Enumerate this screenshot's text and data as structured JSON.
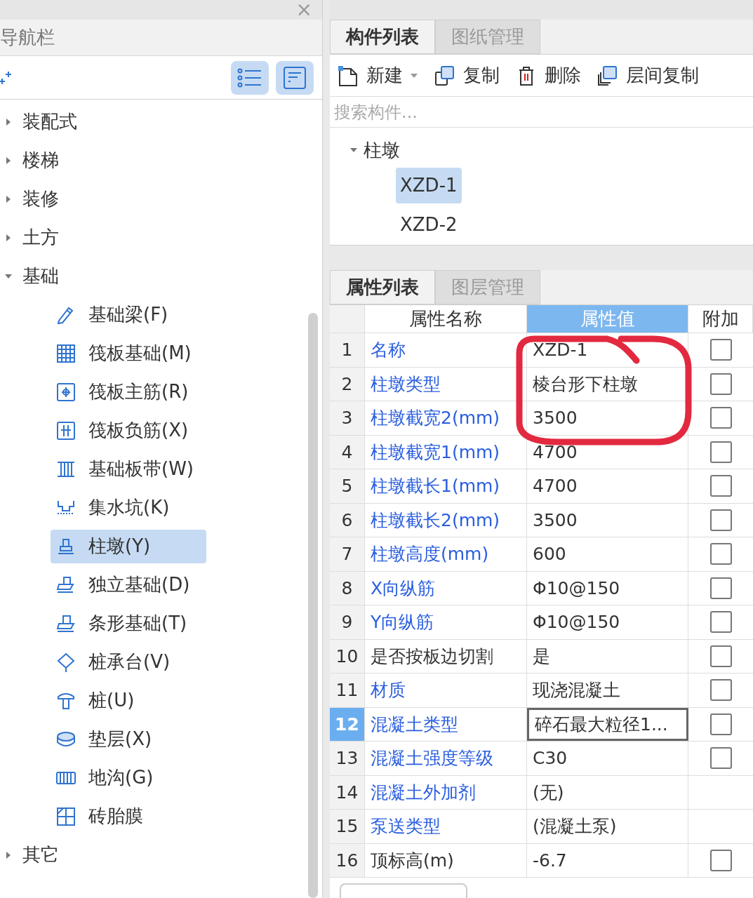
{
  "nav": {
    "close": "×",
    "title": "导航栏",
    "tree": [
      {
        "label": "装配式",
        "expanded": false
      },
      {
        "label": "楼梯",
        "expanded": false
      },
      {
        "label": "装修",
        "expanded": false
      },
      {
        "label": "土方",
        "expanded": false
      },
      {
        "label": "基础",
        "expanded": true,
        "children": [
          {
            "label": "基础梁(F)",
            "selected": false
          },
          {
            "label": "筏板基础(M)",
            "selected": false
          },
          {
            "label": "筏板主筋(R)",
            "selected": false
          },
          {
            "label": "筏板负筋(X)",
            "selected": false
          },
          {
            "label": "基础板带(W)",
            "selected": false
          },
          {
            "label": "集水坑(K)",
            "selected": false
          },
          {
            "label": "柱墩(Y)",
            "selected": true
          },
          {
            "label": "独立基础(D)",
            "selected": false
          },
          {
            "label": "条形基础(T)",
            "selected": false
          },
          {
            "label": "桩承台(V)",
            "selected": false
          },
          {
            "label": "桩(U)",
            "selected": false
          },
          {
            "label": "垫层(X)",
            "selected": false
          },
          {
            "label": "地沟(G)",
            "selected": false
          },
          {
            "label": "砖胎膜",
            "selected": false
          }
        ]
      },
      {
        "label": "其它",
        "expanded": false
      }
    ]
  },
  "component_tabs": [
    {
      "label": "构件列表",
      "selected": true
    },
    {
      "label": "图纸管理",
      "selected": false
    }
  ],
  "toolbar": [
    {
      "label": "新建",
      "kind": "menu"
    },
    {
      "label": "复制",
      "kind": "button"
    },
    {
      "label": "删除",
      "kind": "button"
    },
    {
      "label": "层间复制",
      "kind": "button"
    }
  ],
  "search": {
    "placeholder": "搜索构件..."
  },
  "component_tree": [
    {
      "label": "柱墩",
      "expanded": true,
      "children": [
        {
          "label": "XZD-1",
          "selected": true
        },
        {
          "label": "XZD-2",
          "selected": false
        }
      ]
    }
  ],
  "property_tabs": [
    {
      "label": "属性列表",
      "selected": true
    },
    {
      "label": "图层管理",
      "selected": false
    }
  ],
  "property_table": {
    "columns": [
      {
        "label": "属性名称",
        "selected": false
      },
      {
        "label": "属性值",
        "selected": true
      },
      {
        "label": "附加",
        "selected": false
      }
    ],
    "rows": [
      {
        "number": "1",
        "name": "名称",
        "value": "XZD-1",
        "public": true,
        "selected": false,
        "checkbox": {
          "checked": false
        }
      },
      {
        "number": "2",
        "name": "柱墩类型",
        "value": "棱台形下柱墩",
        "public": true,
        "selected": false,
        "checkbox": {
          "checked": false
        }
      },
      {
        "number": "3",
        "name": "柱墩截宽2(mm)",
        "value": "3500",
        "public": true,
        "selected": false,
        "checkbox": {
          "checked": false
        }
      },
      {
        "number": "4",
        "name": "柱墩截宽1(mm)",
        "value": "4700",
        "public": true,
        "selected": false,
        "checkbox": {
          "checked": false
        }
      },
      {
        "number": "5",
        "name": "柱墩截长1(mm)",
        "value": "4700",
        "public": true,
        "selected": false,
        "checkbox": {
          "checked": false
        }
      },
      {
        "number": "6",
        "name": "柱墩截长2(mm)",
        "value": "3500",
        "public": true,
        "selected": false,
        "checkbox": {
          "checked": false
        }
      },
      {
        "number": "7",
        "name": "柱墩高度(mm)",
        "value": "600",
        "public": true,
        "selected": false,
        "checkbox": {
          "checked": false
        }
      },
      {
        "number": "8",
        "name": "X向纵筋",
        "value": "Φ10@150",
        "public": true,
        "selected": false,
        "checkbox": {
          "checked": false
        }
      },
      {
        "number": "9",
        "name": "Y向纵筋",
        "value": "Φ10@150",
        "public": true,
        "selected": false,
        "checkbox": {
          "checked": false
        }
      },
      {
        "number": "10",
        "name": "是否按板边切割",
        "value": "是",
        "public": false,
        "selected": false,
        "checkbox": {
          "checked": false
        }
      },
      {
        "number": "11",
        "name": "材质",
        "value": "现浇混凝土",
        "public": true,
        "selected": false,
        "checkbox": {
          "checked": false
        }
      },
      {
        "number": "12",
        "name": "混凝土类型",
        "value": "碎石最大粒径1...",
        "public": true,
        "selected": true,
        "checkbox": {
          "checked": false
        }
      },
      {
        "number": "13",
        "name": "混凝土强度等级",
        "value": "C30",
        "public": true,
        "selected": false,
        "checkbox": {
          "checked": false
        }
      },
      {
        "number": "14",
        "name": "混凝土外加剂",
        "value": "(无)",
        "public": true,
        "selected": false
      },
      {
        "number": "15",
        "name": "泵送类型",
        "value": "(混凝土泵)",
        "public": true,
        "selected": false
      },
      {
        "number": "16",
        "name": "顶标高(m)",
        "value": "-6.7",
        "public": false,
        "selected": false,
        "checkbox": {
          "checked": false
        }
      }
    ]
  },
  "annotation": {
    "kind": "circle"
  }
}
